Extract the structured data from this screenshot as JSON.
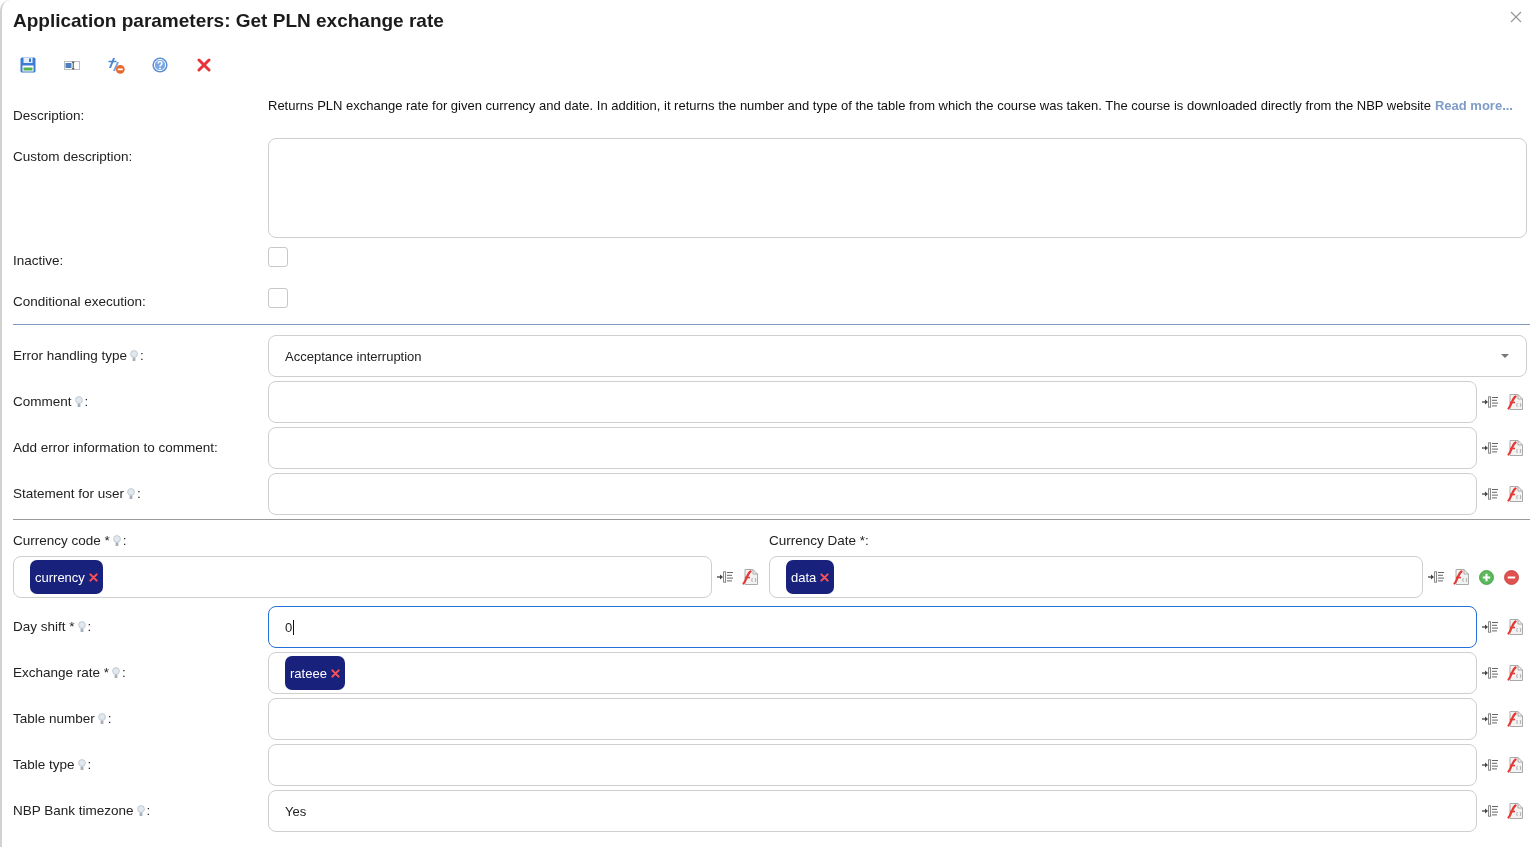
{
  "window": {
    "title": "Application parameters: Get PLN exchange rate"
  },
  "general": {
    "description": {
      "label": "Description:",
      "text": "Returns PLN exchange rate for given currency and date. In addition, it returns the number and type of the table from which the course was taken. The course is downloaded directly from the NBP website",
      "link": "Read more..."
    },
    "custom_description": {
      "label": "Custom description:"
    },
    "checkboxes": [
      {
        "label": "Inactive:",
        "checked": false
      },
      {
        "label": "Conditional execution:",
        "checked": false
      }
    ]
  },
  "error_handling": [
    {
      "kind": "select",
      "label": "Error handling type",
      "hint": true,
      "suffix": ":",
      "value": "Acceptance interruption",
      "focused": false
    },
    {
      "kind": "text",
      "label": "Comment",
      "hint": true,
      "suffix": ":",
      "focused": false
    },
    {
      "kind": "text",
      "label": "Add error information to comment:",
      "hint": false,
      "focused": false
    },
    {
      "kind": "text",
      "label": "Statement for user",
      "hint": true,
      "suffix": ":",
      "focused": false
    }
  ],
  "currency": [
    {
      "label": "Currency code *",
      "hint": true,
      "suffix": ":",
      "tags": [
        "currency"
      ],
      "repeatable": false,
      "focused": false
    },
    {
      "label": "Currency Date *:",
      "hint": false,
      "tags": [
        "data"
      ],
      "repeatable": true,
      "focused": false
    }
  ],
  "inputs": [
    {
      "label": "Day shift *",
      "hint": true,
      "suffix": ":",
      "value": "0",
      "focused": true
    },
    {
      "label": "Exchange rate *",
      "hint": true,
      "suffix": ":",
      "tags": [
        "rateee"
      ],
      "focused": false
    },
    {
      "label": "Table number",
      "hint": true,
      "suffix": ":",
      "focused": false
    },
    {
      "label": "Table type",
      "hint": true,
      "suffix": ":",
      "focused": false
    },
    {
      "label": "NBP Bank timezone",
      "hint": true,
      "suffix": ":",
      "value": "Yes",
      "focused": false
    }
  ]
}
